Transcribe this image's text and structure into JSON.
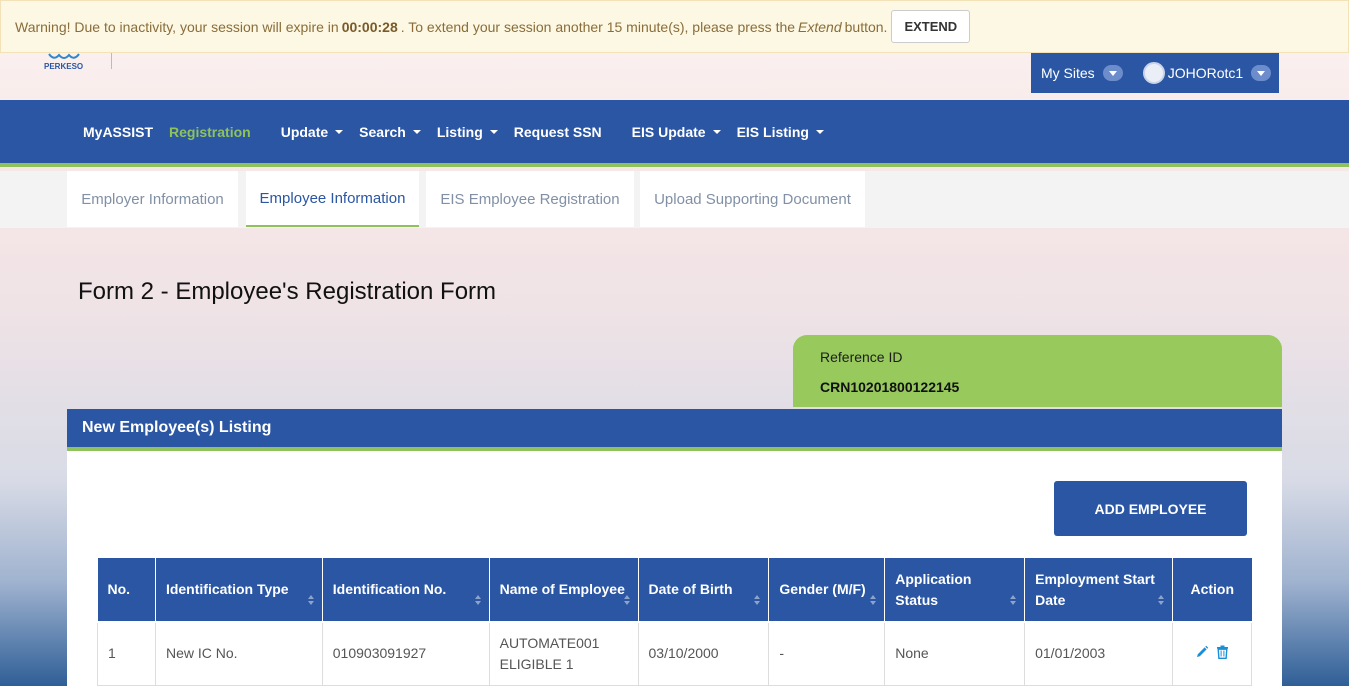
{
  "warning": {
    "prefix": "Warning! Due to inactivity, your session will expire in",
    "countdown": "00:00:28",
    "middle": ". To extend your session another 15 minute(s), please press the",
    "emph": "Extend",
    "suffix": "button.",
    "extend_label": "EXTEND"
  },
  "header": {
    "brand": "PERKESO",
    "my_sites": "My Sites",
    "username": "JOHORotc1"
  },
  "nav": {
    "items": [
      {
        "label": "MyASSIST"
      },
      {
        "label": "Registration"
      },
      {
        "label": "Update"
      },
      {
        "label": "Search"
      },
      {
        "label": "Listing"
      },
      {
        "label": "Request SSN"
      },
      {
        "label": "EIS Update"
      },
      {
        "label": "EIS Listing"
      }
    ]
  },
  "tabs": [
    {
      "label": "Employer Information"
    },
    {
      "label": "Employee Information"
    },
    {
      "label": "EIS Employee Registration"
    },
    {
      "label": "Upload Supporting Document"
    }
  ],
  "page_title": "Form 2 - Employee's Registration Form",
  "reference": {
    "label": "Reference ID",
    "value": "CRN10201800122145"
  },
  "panel": {
    "title": "New Employee(s) Listing",
    "add_button": "ADD EMPLOYEE"
  },
  "table": {
    "columns": [
      {
        "label": "No."
      },
      {
        "label": "Identification Type"
      },
      {
        "label": "Identification No."
      },
      {
        "label": "Name of Employee"
      },
      {
        "label": "Date of Birth"
      },
      {
        "label": "Gender (M/F)"
      },
      {
        "label": "Application Status"
      },
      {
        "label": "Employment Start Date"
      },
      {
        "label": "Action"
      }
    ],
    "rows": [
      {
        "no": "1",
        "id_type": "New IC No.",
        "id_no": "010903091927",
        "name": "AUTOMATE001 ELIGIBLE 1",
        "dob": "03/10/2000",
        "gender": "-",
        "status": "None",
        "start_date": "01/01/2003"
      }
    ]
  },
  "colors": {
    "primary": "#2a56a4",
    "accent_green": "#8fc25c",
    "reference_bg": "#97c95c",
    "warning_bg": "#fcf8e3",
    "warning_text": "#8a6d3b"
  },
  "icons": [
    "pencil-icon",
    "trash-icon",
    "chevron-down-icon",
    "sort-icon",
    "avatar-icon"
  ]
}
